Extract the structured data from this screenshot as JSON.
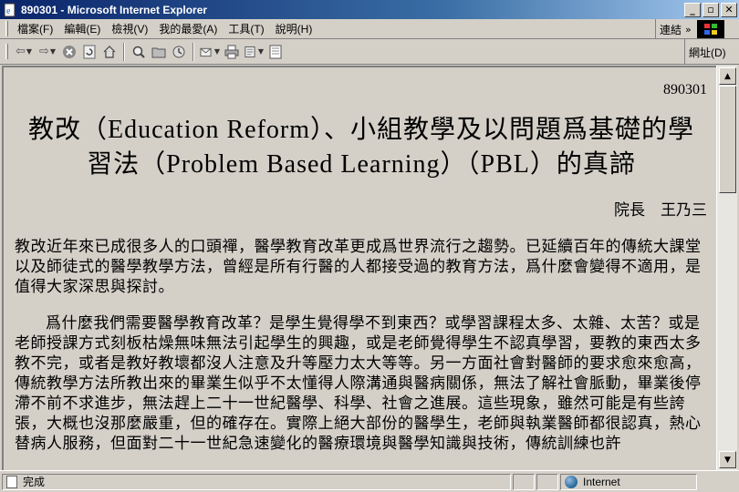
{
  "window": {
    "title": "890301 - Microsoft Internet Explorer"
  },
  "menu": {
    "items": [
      "檔案(F)",
      "編輯(E)",
      "檢視(V)",
      "我的最愛(A)",
      "工具(T)",
      "說明(H)"
    ],
    "links_label": "連結"
  },
  "toolbar": {
    "address_label": "網址(D)"
  },
  "document": {
    "id": "890301",
    "title_line1": "教改（Education Reform）、小組教學及以問題爲基礎的學",
    "title_line2": "習法（Problem Based Learning）（PBL）的真諦",
    "author": "院長　王乃三",
    "paragraphs": [
      "教改近年來已成很多人的口頭禪，醫學教育改革更成爲世界流行之趨勢。已延續百年的傳統大課堂以及師徒式的醫學教學方法，曾經是所有行醫的人都接受過的教育方法，爲什麼會變得不適用，是值得大家深思與探討。",
      "爲什麼我們需要醫學教育改革？是學生覺得學不到東西？或學習課程太多、太雜、太苦？或是老師授課方式刻板枯燥無味無法引起學生的興趣，或是老師覺得學生不認真學習，要教的東西太多教不完，或者是教好教壞都沒人注意及升等壓力太大等等。另一方面社會對醫師的要求愈來愈高，傳統教學方法所教出來的畢業生似乎不太懂得人際溝通與醫病關係，無法了解社會脈動，畢業後停滯不前不求進步，無法趕上二十一世紀醫學、科學、社會之進展。這些現象，雖然可能是有些誇張，大概也沒那麼嚴重，但的確存在。實際上絕大部份的醫學生，老師與執業醫師都很認真，熱心替病人服務，但面對二十一世紀急速變化的醫療環境與醫學知識與技術，傳統訓練也許"
    ]
  },
  "status": {
    "text": "完成",
    "zone": "Internet"
  }
}
